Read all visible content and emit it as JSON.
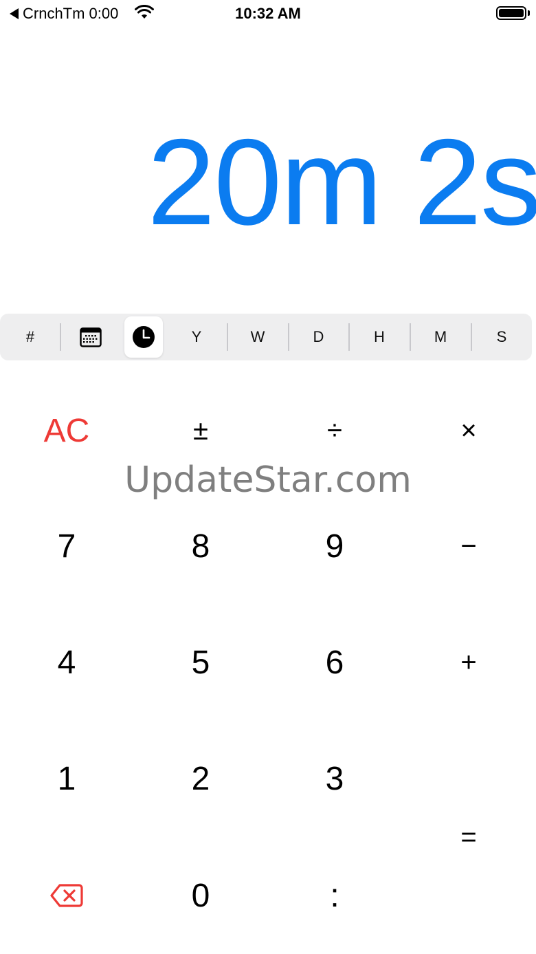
{
  "status_bar": {
    "back_app": "CrnchTm 0:00",
    "time": "10:32 AM"
  },
  "display": {
    "value": "20m 2s",
    "color": "#0B7CF0"
  },
  "unit_selector": {
    "selected": "clock",
    "units": [
      {
        "id": "number",
        "label": "#"
      },
      {
        "id": "calendar",
        "icon": "calendar-icon"
      },
      {
        "id": "clock",
        "icon": "clock-icon"
      },
      {
        "id": "years",
        "label": "Y"
      },
      {
        "id": "weeks",
        "label": "W"
      },
      {
        "id": "days",
        "label": "D"
      },
      {
        "id": "hours",
        "label": "H"
      },
      {
        "id": "minutes",
        "label": "M"
      },
      {
        "id": "seconds",
        "label": "S"
      }
    ]
  },
  "keypad": {
    "all_clear": "AC",
    "plus_minus": "±",
    "divide": "÷",
    "multiply": "×",
    "seven": "7",
    "eight": "8",
    "nine": "9",
    "minus": "−",
    "four": "4",
    "five": "5",
    "six": "6",
    "plus": "+",
    "one": "1",
    "two": "2",
    "three": "3",
    "equals": "=",
    "zero": "0",
    "colon": ":",
    "backspace_icon": "backspace-icon",
    "accent_red": "#EE3A36"
  },
  "watermark": {
    "text": "UpdateStar.com"
  }
}
